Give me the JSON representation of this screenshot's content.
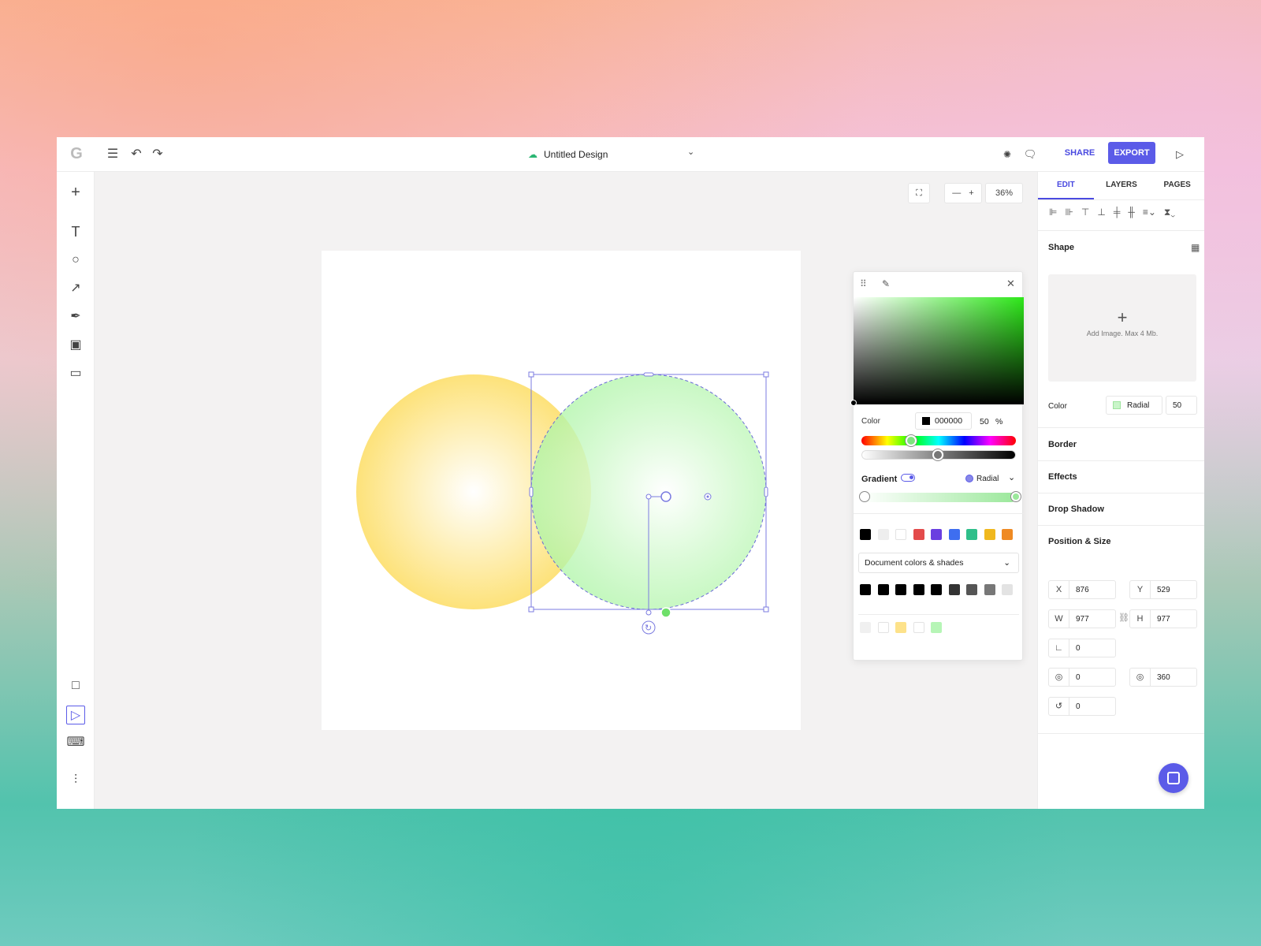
{
  "app": {
    "title": "Untitled Design",
    "share_label": "SHARE",
    "export_label": "EXPORT",
    "zoom": "36%",
    "accent": "#5b5be8"
  },
  "tabs": [
    "EDIT",
    "LAYERS",
    "PAGES"
  ],
  "panel": {
    "shape_label": "Shape",
    "add_image_text": "Add Image. Max 4 Mb.",
    "color_label": "Color",
    "color_mode": "Radial",
    "color_opacity": "50",
    "border_label": "Border",
    "effects_label": "Effects",
    "drop_shadow_label": "Drop Shadow",
    "position_size_label": "Position & Size",
    "x_label": "X",
    "x": "876",
    "y_label": "Y",
    "y": "529",
    "w_label": "W",
    "w": "977",
    "h_label": "H",
    "h": "977",
    "corner": "0",
    "arc_start": "0",
    "arc_end": "360",
    "rotation": "0"
  },
  "picker": {
    "color_label": "Color",
    "hex": "000000",
    "opacity": "50",
    "percent": "%",
    "gradient_label": "Gradient",
    "gradient_type": "Radial",
    "doc_colors_label": "Document colors & shades",
    "swatches_row1": [
      "#000000",
      "#eeeeee",
      "#ffffff",
      "#e34b4b",
      "#6a3fe0",
      "#3e6ef0",
      "#2fbf8a",
      "#f0b81e",
      "#ef8a23"
    ],
    "swatches_row2": [
      "#000000",
      "#000000",
      "#000000",
      "#000000",
      "#000000",
      "#333333",
      "#555555",
      "#777777",
      "#e3e3e3"
    ],
    "swatches_row3": [
      "#f0f0f0",
      "#ffffff",
      "#fde28a",
      "#ffffff",
      "#b6f5b6"
    ]
  },
  "shapes": {
    "yellow_circle_color": "#fde27a",
    "green_circle_color": "#b8f7b0"
  }
}
